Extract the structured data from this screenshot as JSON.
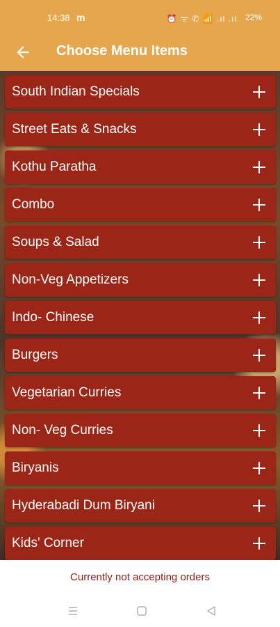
{
  "status": {
    "time": "14:38",
    "carrier_glyph": "m",
    "icons": "⏰ ᯤ ✆ 📶 .ıl .ıl",
    "battery": "22%"
  },
  "appbar": {
    "title": "Choose Menu Items",
    "back_icon": "arrow-left"
  },
  "menu": {
    "items": [
      {
        "label": "South Indian Specials"
      },
      {
        "label": "Street Eats & Snacks"
      },
      {
        "label": "Kothu Paratha"
      },
      {
        "label": "Combo"
      },
      {
        "label": "Soups & Salad"
      },
      {
        "label": "Non-Veg Appetizers"
      },
      {
        "label": "Indo- Chinese"
      },
      {
        "label": "Burgers"
      },
      {
        "label": "Vegetarian Curries"
      },
      {
        "label": "Non- Veg Curries"
      },
      {
        "label": "Biryanis"
      },
      {
        "label": "Hyderabadi Dum Biryani"
      },
      {
        "label": "Kids' Corner"
      }
    ],
    "expand_icon": "plus"
  },
  "footer": {
    "notice": "Currently not accepting orders"
  },
  "navbar": {
    "buttons": [
      "menu-icon",
      "home-square-icon",
      "back-triangle-icon"
    ]
  },
  "colors": {
    "header": "#e6a64e",
    "item_bg": "#9b2516",
    "notice_text": "#8c1c12"
  }
}
